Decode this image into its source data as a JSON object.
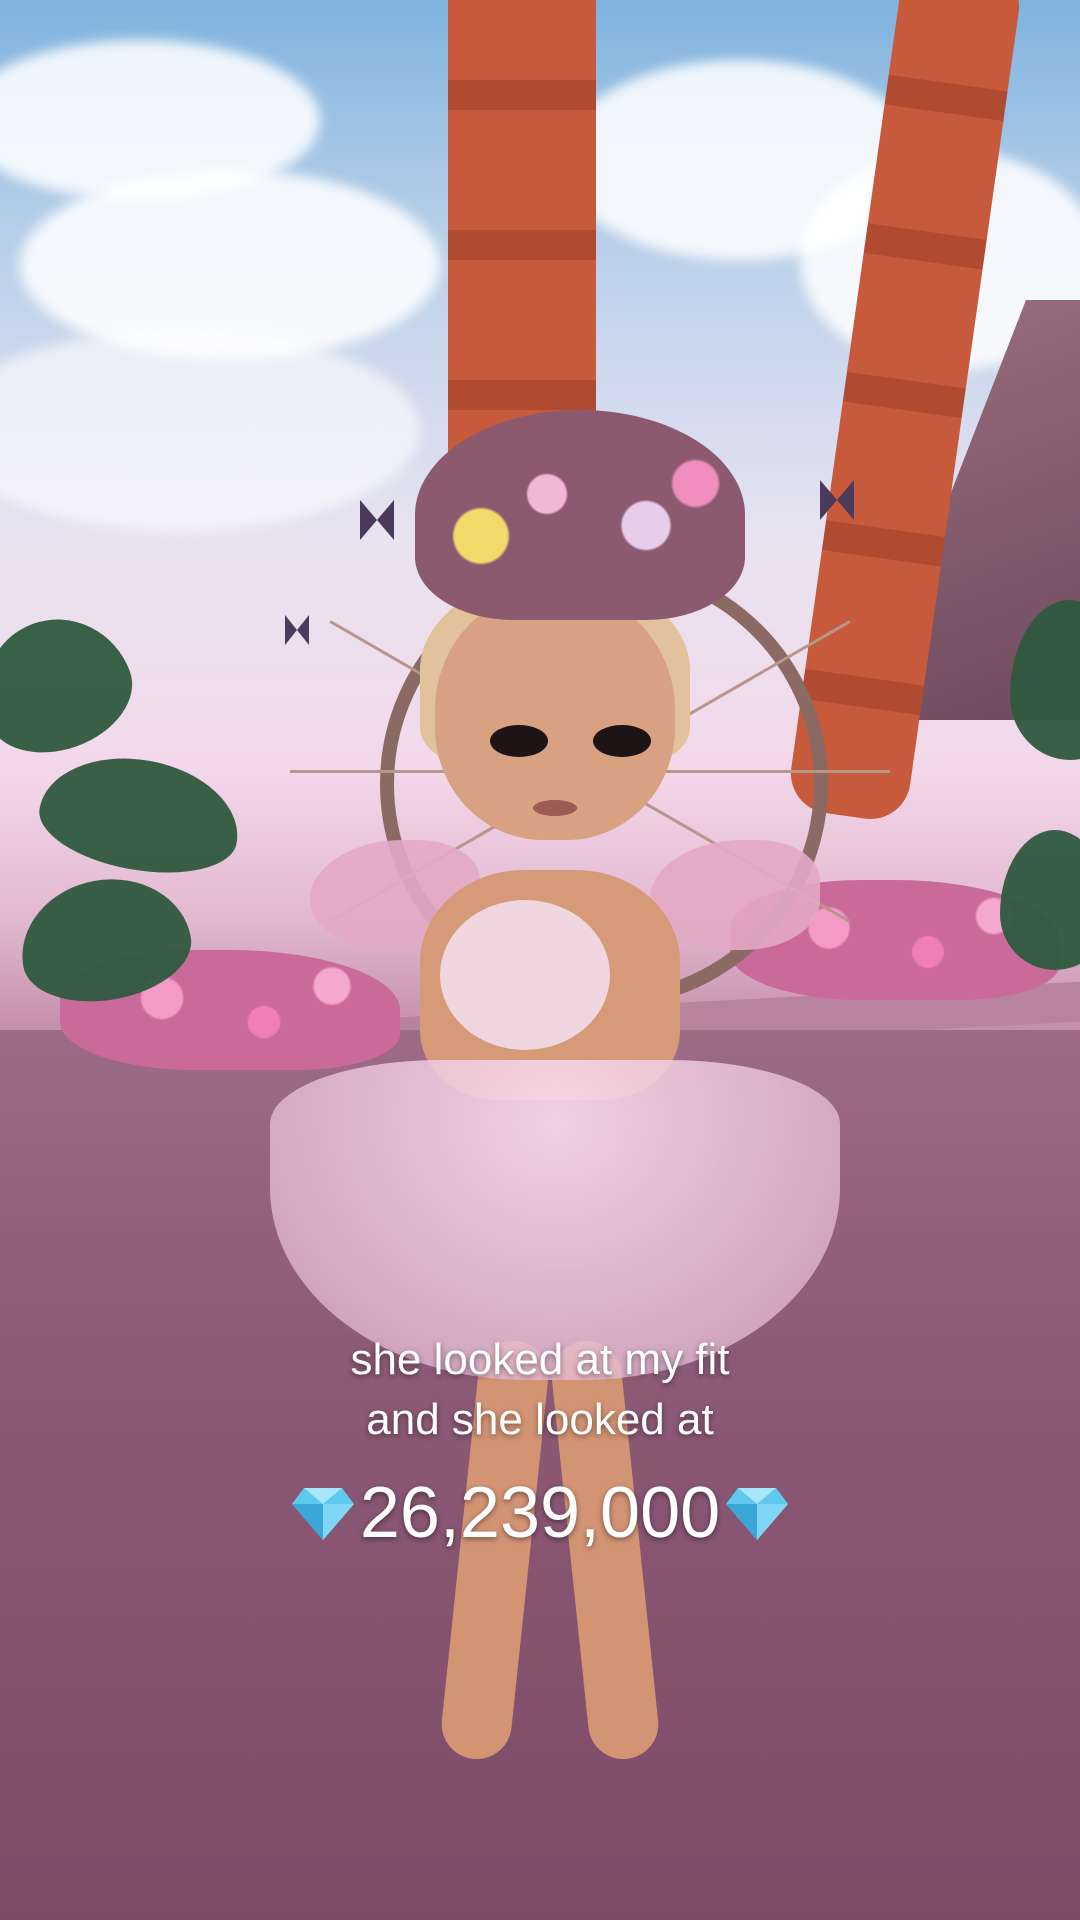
{
  "caption": {
    "line1": "she looked at my fit",
    "line2": "and she looked at",
    "amount": "26,239,000"
  },
  "icons": {
    "left_gem": "diamond-icon",
    "right_gem": "diamond-icon"
  },
  "colors": {
    "caption_text": "#ffffff",
    "gem": "#5ec8ee",
    "ground": "#8d5b77",
    "sky": "#7fb3de"
  }
}
